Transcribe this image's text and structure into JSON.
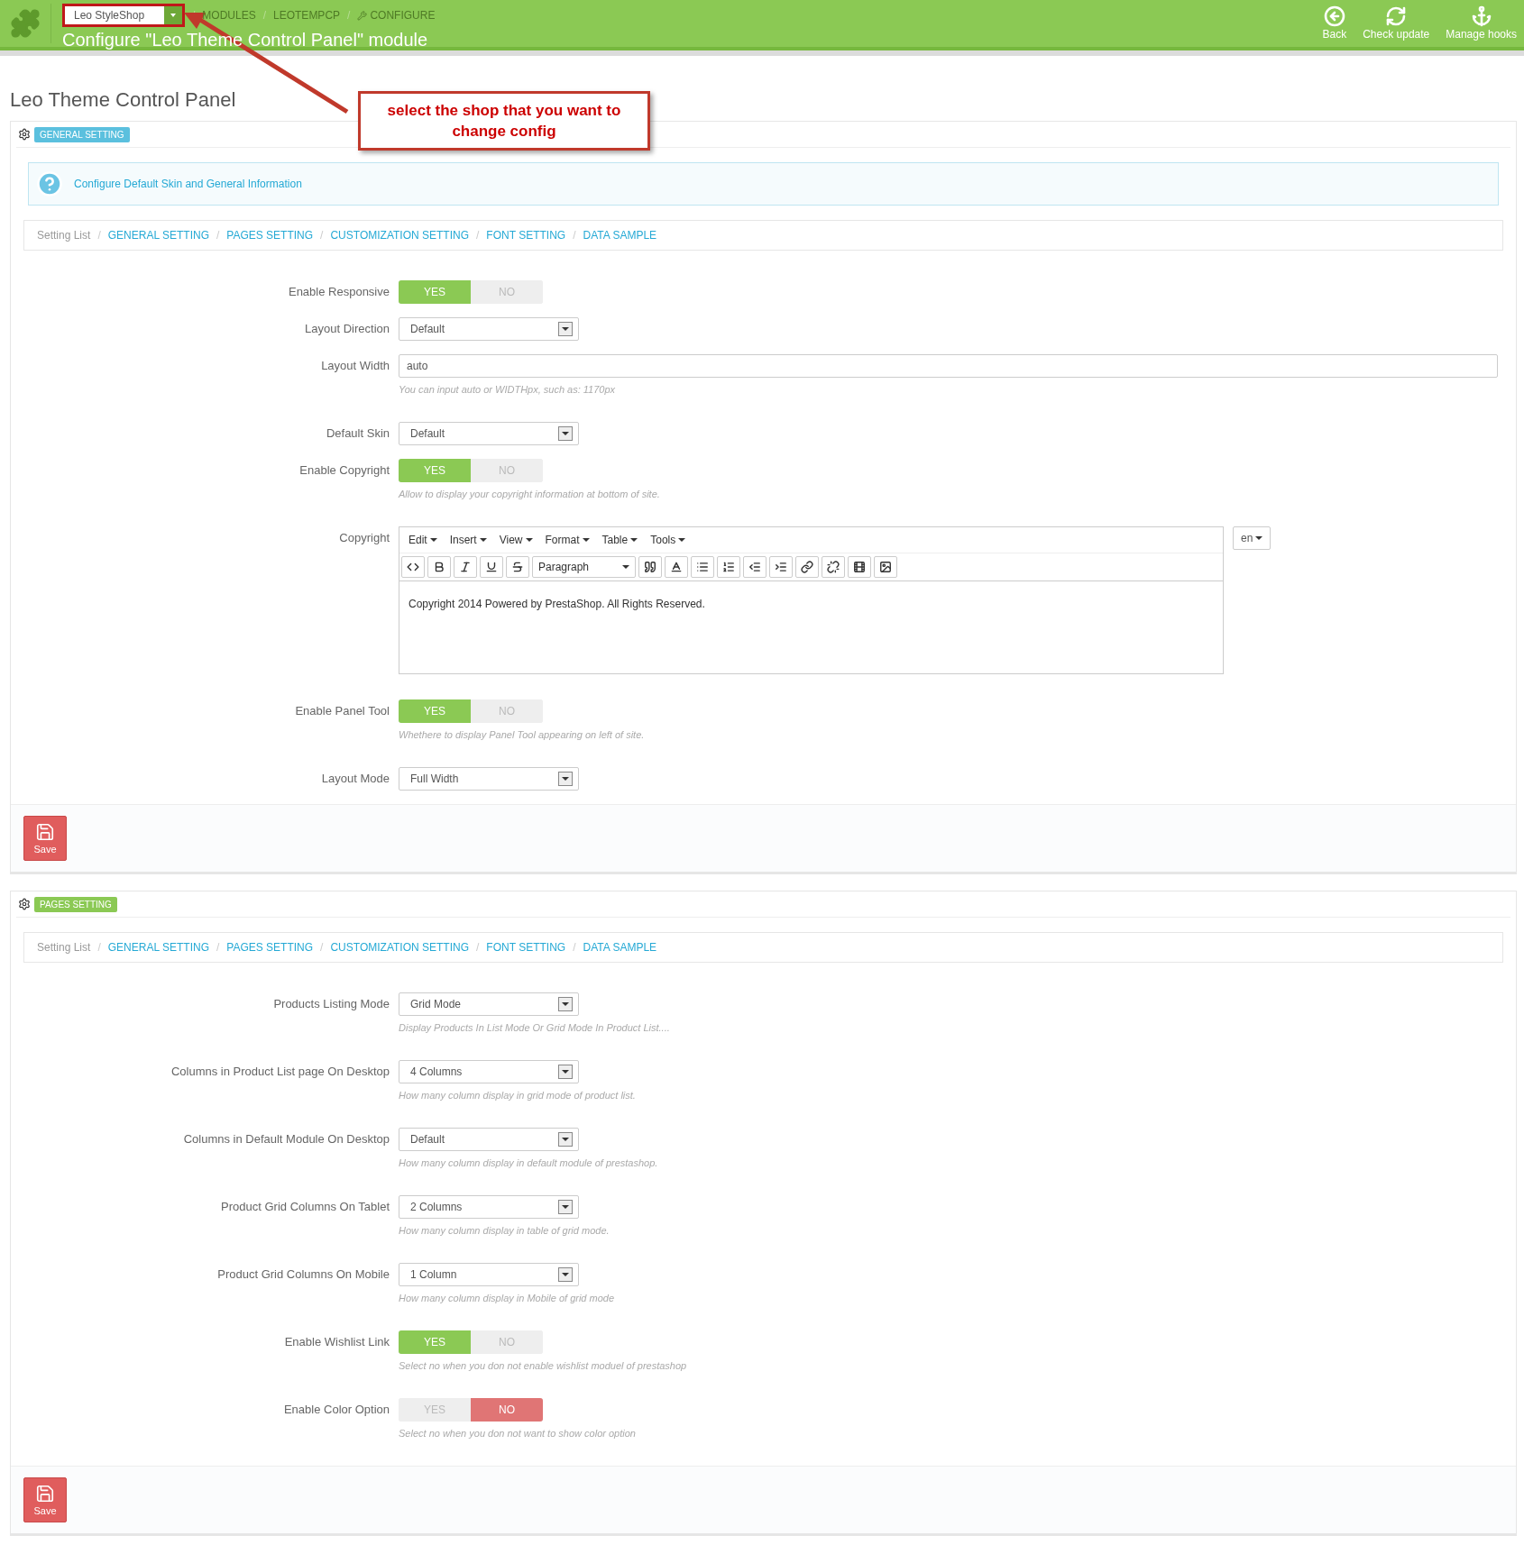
{
  "header": {
    "shop_selector": "Leo StyleShop",
    "breadcrumb": [
      "MODULES",
      "LEOTEMPCP",
      "CONFIGURE"
    ],
    "breadcrumb_separator": "/",
    "title": "Configure \"Leo Theme Control Panel\" module",
    "toolbar": [
      {
        "kind": "back",
        "label": "Back"
      },
      {
        "kind": "refresh",
        "label": "Check update"
      },
      {
        "kind": "anchor",
        "label": "Manage hooks"
      }
    ]
  },
  "annotation": {
    "text": "select the shop that you want to change config"
  },
  "page_title": "Leo Theme Control Panel",
  "panels": [
    {
      "badge": "GENERAL SETTING",
      "color": "#5bc0de",
      "alert": "Configure Default Skin and General Information",
      "breadcrumb": {
        "lead": "Setting List",
        "separator": "/",
        "links": [
          "GENERAL SETTING",
          "PAGES SETTING",
          "CUSTOMIZATION SETTING",
          "FONT SETTING",
          "DATA SAMPLE"
        ]
      },
      "fields": [
        {
          "kind": "toggle",
          "label": "Enable Responsive",
          "yes": "YES",
          "no": "NO",
          "on": true
        },
        {
          "kind": "select",
          "label": "Layout Direction",
          "value": "Default"
        },
        {
          "kind": "text",
          "label": "Layout Width",
          "value": "auto",
          "hint": "You can input auto or WIDTHpx, such as: 1170px"
        },
        {
          "kind": "select",
          "label": "Default Skin",
          "value": "Default"
        },
        {
          "kind": "toggle",
          "label": "Enable Copyright",
          "yes": "YES",
          "no": "NO",
          "on": true,
          "hint": "Allow to display your copyright information at bottom of site."
        },
        {
          "kind": "editor",
          "label": "Copyright",
          "menus": [
            "Edit",
            "Insert",
            "View",
            "Format",
            "Table",
            "Tools"
          ],
          "format": "Paragraph",
          "content": "Copyright 2014 Powered by PrestaShop. All Rights Reserved.",
          "language": "en"
        },
        {
          "kind": "toggle",
          "label": "Enable Panel Tool",
          "yes": "YES",
          "no": "NO",
          "on": true,
          "hint": "Whethere to display Panel Tool appearing on left of site."
        },
        {
          "kind": "select",
          "label": "Layout Mode",
          "value": "Full Width"
        }
      ],
      "save": "Save"
    },
    {
      "badge": "PAGES SETTING",
      "color": "#8bc954",
      "breadcrumb": {
        "lead": "Setting List",
        "separator": "/",
        "links": [
          "GENERAL SETTING",
          "PAGES SETTING",
          "CUSTOMIZATION SETTING",
          "FONT SETTING",
          "DATA SAMPLE"
        ]
      },
      "fields": [
        {
          "kind": "select",
          "label": "Products Listing Mode",
          "value": "Grid Mode",
          "hint": "Display Products In List Mode Or Grid Mode In Product List...."
        },
        {
          "kind": "select",
          "label": "Columns in Product List page On Desktop",
          "value": "4 Columns",
          "hint": "How many column display in grid mode of product list."
        },
        {
          "kind": "select",
          "label": "Columns in Default Module On Desktop",
          "value": "Default",
          "hint": "How many column display in default module of prestashop."
        },
        {
          "kind": "select",
          "label": "Product Grid Columns On Tablet",
          "value": "2 Columns",
          "hint": "How many column display in table of grid mode."
        },
        {
          "kind": "select",
          "label": "Product Grid Columns On Mobile",
          "value": "1 Column",
          "hint": "How many column display in Mobile of grid mode"
        },
        {
          "kind": "toggle",
          "label": "Enable Wishlist Link",
          "yes": "YES",
          "no": "NO",
          "on": true,
          "hint": "Select no when you don not enable wishlist moduel of prestashop"
        },
        {
          "kind": "toggle",
          "label": "Enable Color Option",
          "yes": "YES",
          "no": "NO",
          "on": false,
          "hint": "Select no when you don not want to show color option"
        }
      ],
      "save": "Save"
    }
  ]
}
